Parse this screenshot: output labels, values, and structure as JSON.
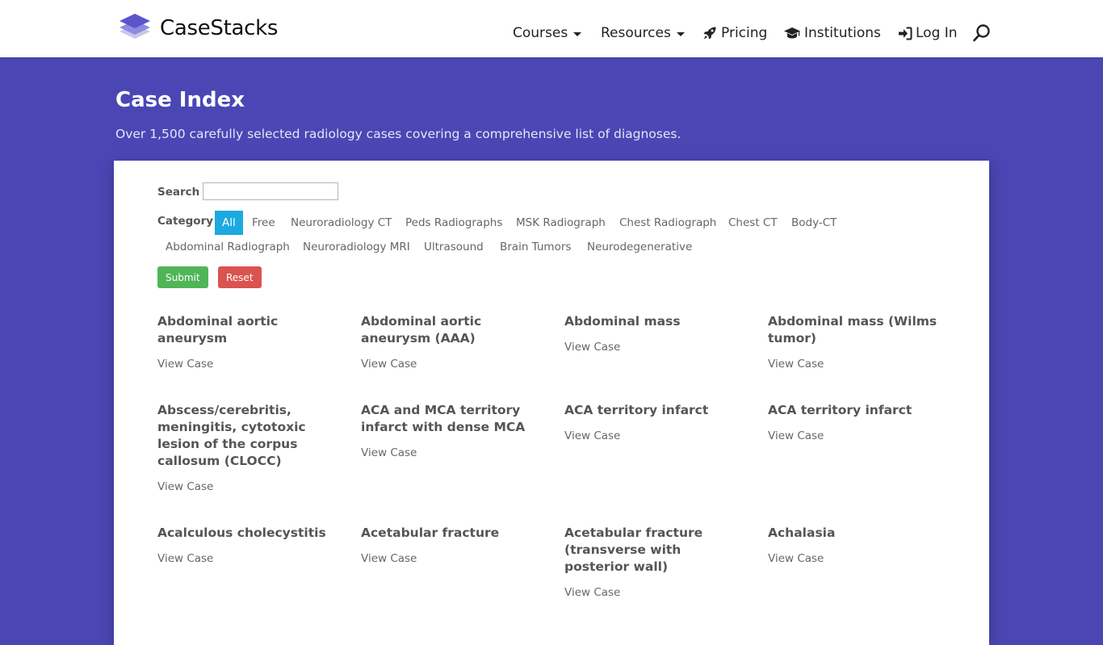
{
  "header": {
    "brand": "CaseStacks",
    "nav": [
      {
        "label": "Courses",
        "dropdown": true
      },
      {
        "label": "Resources",
        "dropdown": true
      },
      {
        "label": "Pricing",
        "icon": "rocket-icon"
      },
      {
        "label": "Institutions",
        "icon": "graduation-cap-icon"
      },
      {
        "label": "Log In",
        "icon": "sign-in-icon"
      }
    ],
    "search_icon": "search-icon"
  },
  "hero": {
    "title": "Case Index",
    "subtitle": "Over 1,500 carefully selected radiology cases covering a comprehensive list of diagnoses."
  },
  "filters": {
    "search_label": "Search",
    "search_value": "",
    "category_label": "Category",
    "categories": [
      "All",
      "Free",
      "Neuroradiology CT",
      "Peds Radiographs",
      "MSK Radiograph",
      "Chest Radiograph",
      "Chest CT",
      "Body-CT",
      "Abdominal Radiograph",
      "Neuroradiology MRI",
      "Ultrasound",
      "Brain Tumors",
      "Neurodegenerative"
    ],
    "active_category": "All",
    "submit_label": "Submit",
    "reset_label": "Reset"
  },
  "cases": [
    {
      "title": "Abdominal aortic aneurysm",
      "link": "View Case"
    },
    {
      "title": "Abdominal aortic aneurysm (AAA)",
      "link": "View Case"
    },
    {
      "title": "Abdominal mass",
      "link": "View Case"
    },
    {
      "title": "Abdominal mass (Wilms tumor)",
      "link": "View Case"
    },
    {
      "title": "Abscess/cerebritis, meningitis, cytotoxic lesion of the corpus callosum (CLOCC)",
      "link": "View Case"
    },
    {
      "title": "ACA and MCA territory infarct with dense MCA",
      "link": "View Case"
    },
    {
      "title": "ACA territory infarct",
      "link": "View Case"
    },
    {
      "title": "ACA territory infarct",
      "link": "View Case"
    },
    {
      "title": "Acalculous cholecystitis",
      "link": "View Case"
    },
    {
      "title": "Acetabular fracture",
      "link": "View Case"
    },
    {
      "title": "Acetabular fracture (transverse with posterior wall)",
      "link": "View Case"
    },
    {
      "title": "Achalasia",
      "link": "View Case"
    }
  ],
  "colors": {
    "page_background": "#4a47b5",
    "active_category": "#1ba9e0",
    "submit": "#4fb557",
    "reset": "#d9534f"
  }
}
